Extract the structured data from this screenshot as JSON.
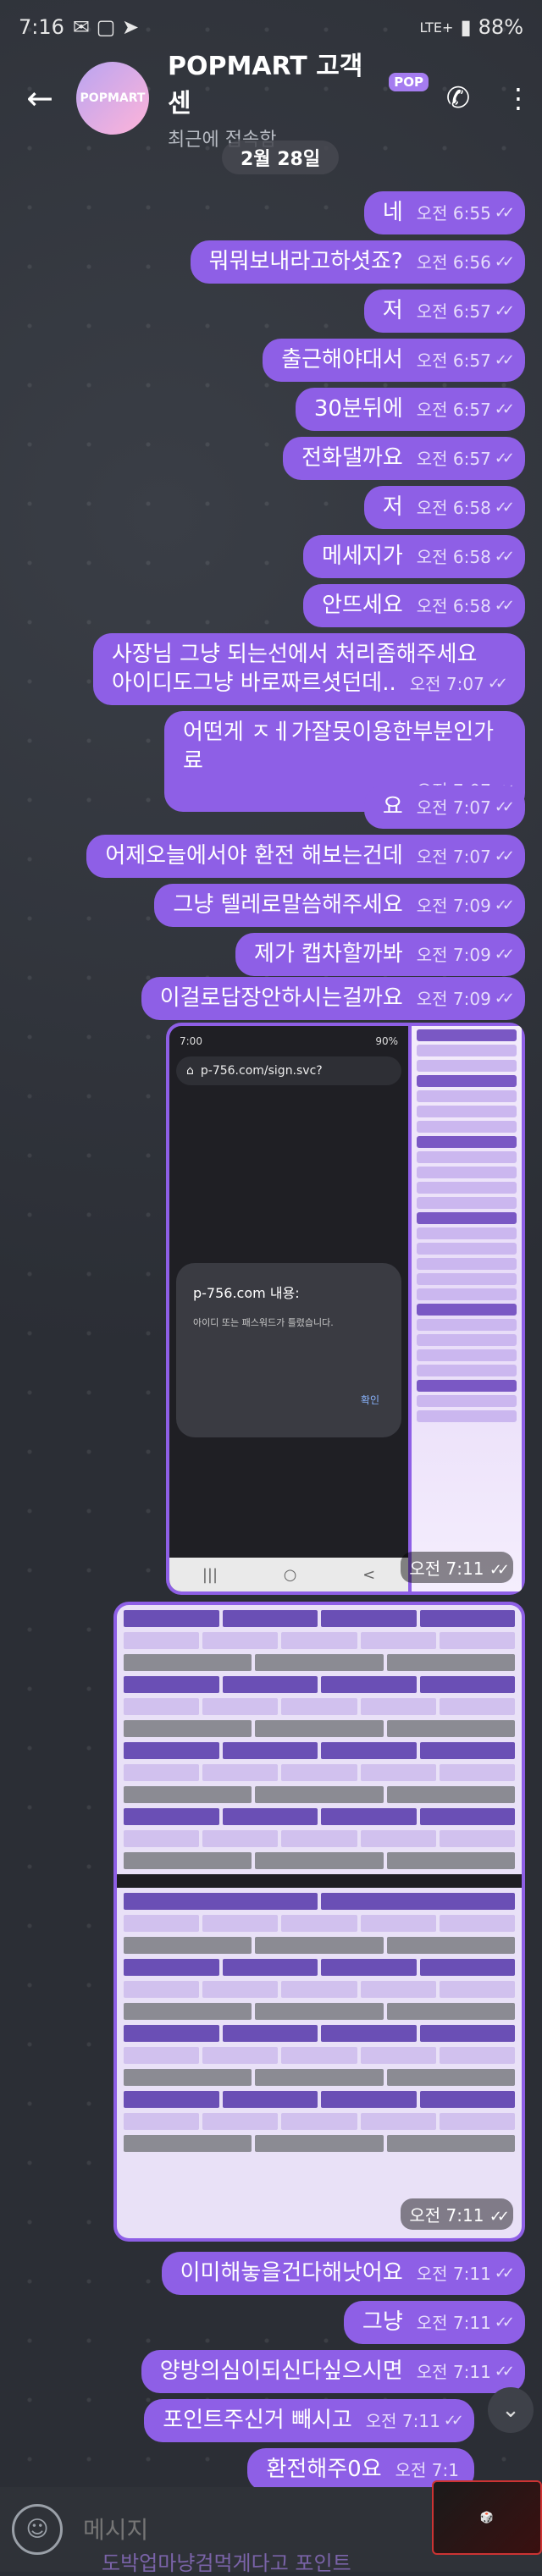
{
  "status_bar": {
    "time": "7:16",
    "battery": "88%",
    "network": "LTE+"
  },
  "header": {
    "title": "POPMART 고객센",
    "badge": "POP",
    "subtitle": "최근에 접속함",
    "avatar_text": "POPMART"
  },
  "date_pill": "2월 28일",
  "messages": [
    {
      "text": "네",
      "time": "오전 6:55"
    },
    {
      "text": "뭐뭐보내라고하셧죠?",
      "time": "오전 6:56"
    },
    {
      "text": "저",
      "time": "오전 6:57"
    },
    {
      "text": "출근해야대서",
      "time": "오전 6:57"
    },
    {
      "text": "30분뒤에",
      "time": "오전 6:57"
    },
    {
      "text": "전화댈까요",
      "time": "오전 6:57"
    },
    {
      "text": "저",
      "time": "오전 6:58"
    },
    {
      "text": "메세지가",
      "time": "오전 6:58"
    },
    {
      "text": "안뜨세요",
      "time": "오전 6:58"
    },
    {
      "text": "사장님 그냥 되는선에서 처리좀해주세요",
      "text2": "아이디도그냥 바로짜르셧던데..",
      "time": "오전 7:07"
    },
    {
      "text": "어떤게 ㅈㅔ가잘못이용한부분인가료",
      "time": "오전 7:07"
    },
    {
      "text": "요",
      "time": "오전 7:07"
    },
    {
      "text": "어제오늘에서야 환전 해보는건데",
      "time": "오전 7:07"
    },
    {
      "text": "그냥 텔레로말씀해주세요",
      "time": "오전 7:09"
    },
    {
      "text": "제가 캡차할까봐",
      "time": "오전 7:09"
    },
    {
      "text": "이걸로답장안하시는걸까요",
      "time": "오전 7:09"
    }
  ],
  "image1": {
    "time": "오전 7:11",
    "url": "p-756.com/sign.svc?",
    "phone_time": "7:00",
    "phone_battery": "90%",
    "dialog_title": "p-756.com 내용:",
    "dialog_body": "아이디 또는 패스워드가 틀렸습니다.",
    "dialog_ok": "확인"
  },
  "image2": {
    "time": "오전 7:11"
  },
  "messages_after": [
    {
      "text": "이미해놓을건다해낫어요",
      "time": "오전 7:11"
    },
    {
      "text": "그냥",
      "time": "오전 7:11"
    },
    {
      "text": "양방의심이되신다싶으시면",
      "time": "오전 7:11"
    },
    {
      "text": "포인트주신거 빼시고",
      "time": "오전 7:11"
    },
    {
      "text": "환전해주0요",
      "time": "오전 7:1"
    }
  ],
  "peek_text": "도박업마냥검먹게다고 포인트",
  "composer": {
    "placeholder": "메시지"
  },
  "icons": [
    "back-arrow-icon",
    "phone-icon",
    "more-vert-icon",
    "emoji-icon",
    "attach-icon",
    "scroll-down-icon",
    "read-ticks-icon"
  ],
  "colors": {
    "bubble": "#8e5fe6",
    "background": "#2b2e35"
  }
}
